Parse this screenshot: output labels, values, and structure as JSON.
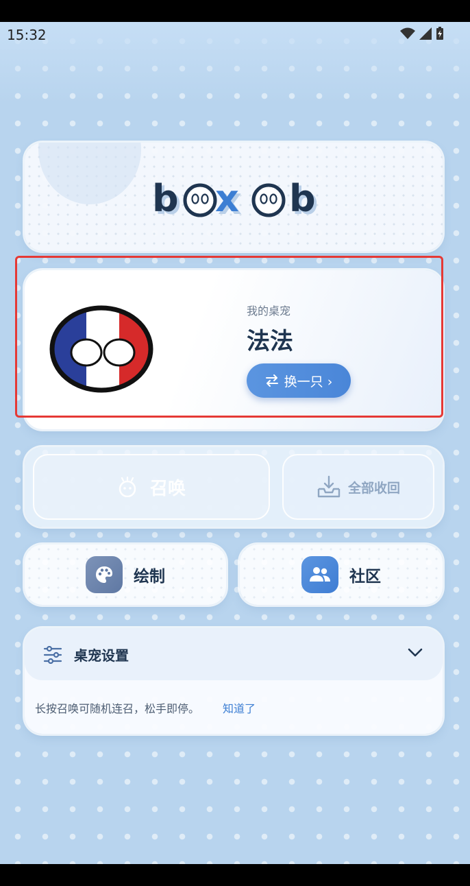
{
  "status_bar": {
    "time": "15:32"
  },
  "logo": {
    "text": "boxob"
  },
  "pet": {
    "subtitle": "我的桌宠",
    "name": "法法",
    "switch_label": "换一只 ›"
  },
  "actions": {
    "summon_label": "召唤",
    "recall_label": "全部收回"
  },
  "features": {
    "draw_label": "绘制",
    "community_label": "社区"
  },
  "settings": {
    "title": "桌宠设置",
    "tip": "长按召唤可随机连召，松手即停。",
    "dismiss_label": "知道了"
  },
  "colors": {
    "accent": "#4a86d8",
    "highlight": "#e53935",
    "text_primary": "#1f3550"
  }
}
